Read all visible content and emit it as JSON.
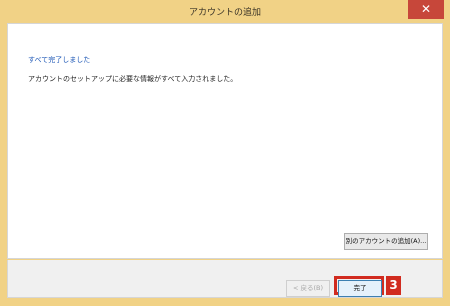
{
  "window": {
    "title": "アカウントの追加",
    "close_glyph": "✕"
  },
  "content": {
    "heading": "すべて完了しました",
    "message": "アカウントのセットアップに必要な情報がすべて入力されました。",
    "add_another_label": "別のアカウントの追加(A)..."
  },
  "footer": {
    "back_label": "< 戻る(B)",
    "finish_label": "完了",
    "step_badge": "3"
  },
  "colors": {
    "titlebar": "#f1d286",
    "close_button": "#c7473a",
    "heading_text": "#1d57b6",
    "highlight": "#d12b1f"
  }
}
